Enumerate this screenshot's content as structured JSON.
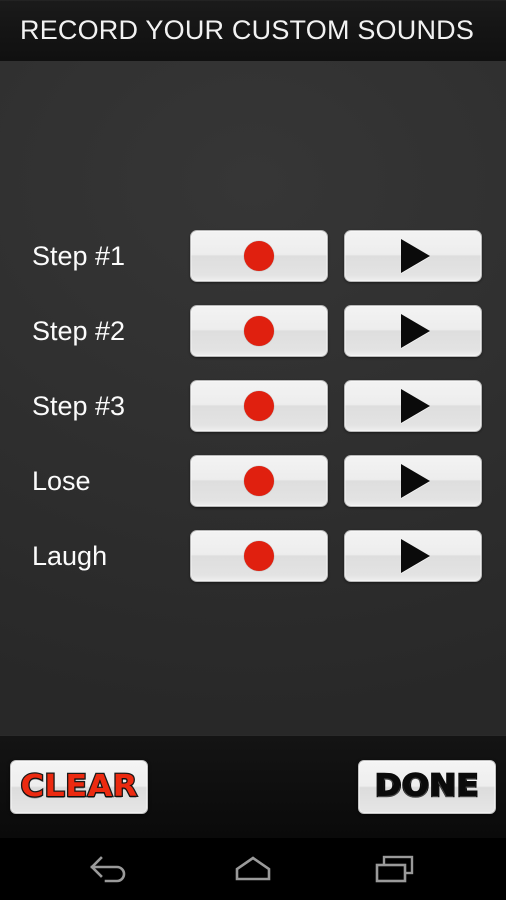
{
  "header": {
    "title": "RECORD YOUR CUSTOM SOUNDS"
  },
  "main": {
    "rows": [
      {
        "label": "Step #1",
        "record_icon": "record-dot-icon",
        "play_icon": "play-triangle-icon"
      },
      {
        "label": "Step #2",
        "record_icon": "record-dot-icon",
        "play_icon": "play-triangle-icon"
      },
      {
        "label": "Step #3",
        "record_icon": "record-dot-icon",
        "play_icon": "play-triangle-icon"
      },
      {
        "label": "Lose",
        "record_icon": "record-dot-icon",
        "play_icon": "play-triangle-icon"
      },
      {
        "label": "Laugh",
        "record_icon": "record-dot-icon",
        "play_icon": "play-triangle-icon"
      }
    ]
  },
  "actionbar": {
    "clear_label": "CLEAR",
    "done_label": "DONE"
  },
  "navbar": {
    "back_icon": "back-arrow-icon",
    "home_icon": "home-icon",
    "recents_icon": "recent-apps-icon"
  },
  "colors": {
    "titlebar_bg": "#141414",
    "content_bg": "#303030",
    "actionbar_bg": "#0e0e0e",
    "record_red": "#e0200f",
    "clear_red": "#ec2a10",
    "button_face": "#ededed",
    "label_text": "#fbfbfb"
  }
}
